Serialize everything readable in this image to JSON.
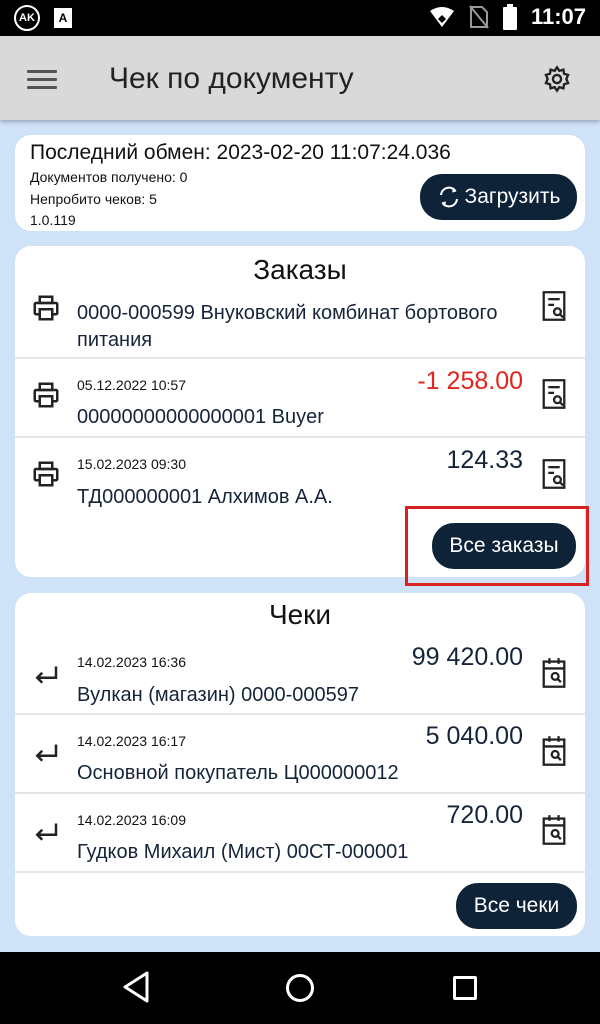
{
  "status_bar": {
    "time": "11:07",
    "left_badge": "AK",
    "left_icon": "A"
  },
  "app_bar": {
    "title": "Чек по документу"
  },
  "sync": {
    "last_exchange": "Последний обмен: 2023-02-20 11:07:24.036",
    "docs_received": "Документов получено: 0",
    "unprinted": "Непробито чеков: 5",
    "version": "1.0.119",
    "load_label": "Загрузить"
  },
  "orders": {
    "title": "Заказы",
    "items": [
      {
        "date": "",
        "name": "0000-000599 Внуковский комбинат бортового питания",
        "amount": ""
      },
      {
        "date": "05.12.2022 10:57",
        "name": "00000000000000001 Buyer",
        "amount": "-1 258.00"
      },
      {
        "date": "15.02.2023 09:30",
        "name": "ТД000000001 Алхимов А.А.",
        "amount": "124.33"
      }
    ],
    "all_label": "Все заказы"
  },
  "checks": {
    "title": "Чеки",
    "items": [
      {
        "date": "14.02.2023 16:36",
        "name": "Вулкан (магазин) 0000-000597",
        "amount": "99 420.00"
      },
      {
        "date": "14.02.2023 16:17",
        "name": "Основной покупатель Ц000000012",
        "amount": "5 040.00"
      },
      {
        "date": "14.02.2023 16:09",
        "name": "Гудков Михаил (Мист) 00СТ-000001",
        "amount": "720.00"
      }
    ],
    "all_label": "Все чеки"
  },
  "colors": {
    "accent": "#0e2238",
    "negative": "#e3241b",
    "background": "#cfe2f7",
    "highlight": "#d82222"
  },
  "icons": {
    "menu": "hamburger-icon",
    "settings": "gear-icon",
    "refresh": "refresh-icon",
    "order": "printer-icon",
    "check": "return-arrow-icon",
    "order_doc": "document-search-icon",
    "check_doc": "calendar-search-icon"
  }
}
